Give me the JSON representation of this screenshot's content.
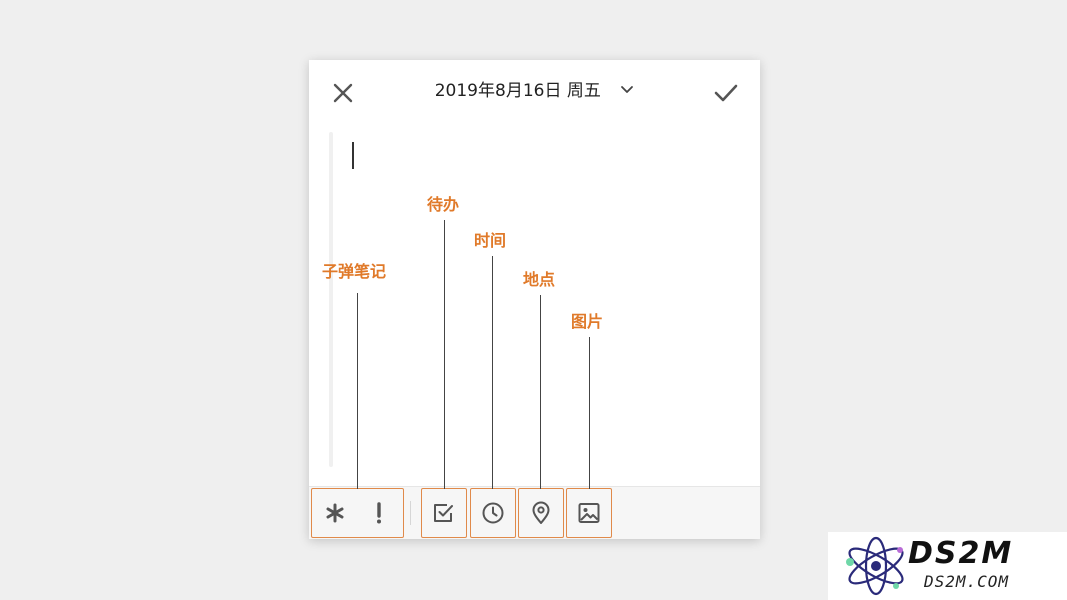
{
  "header": {
    "date_title": "2019年8月16日 周五",
    "close_icon": "close-icon",
    "confirm_icon": "checkmark-icon",
    "dropdown_icon": "chevron-down-icon"
  },
  "toolbar": {
    "buttons": [
      {
        "icon": "asterisk-icon"
      },
      {
        "icon": "exclamation-icon"
      },
      {
        "icon": "checkbox-icon"
      },
      {
        "icon": "clock-icon"
      },
      {
        "icon": "location-pin-icon"
      },
      {
        "icon": "image-icon"
      }
    ]
  },
  "annotations": {
    "bullet_note": "子弹笔记",
    "todo": "待办",
    "time": "时间",
    "location": "地点",
    "image": "图片"
  },
  "watermark": {
    "brand": "DS2M",
    "domain": "DS2M.COM"
  },
  "colors": {
    "accent": "#e07a2a",
    "icon": "#555555",
    "background": "#efefef"
  }
}
